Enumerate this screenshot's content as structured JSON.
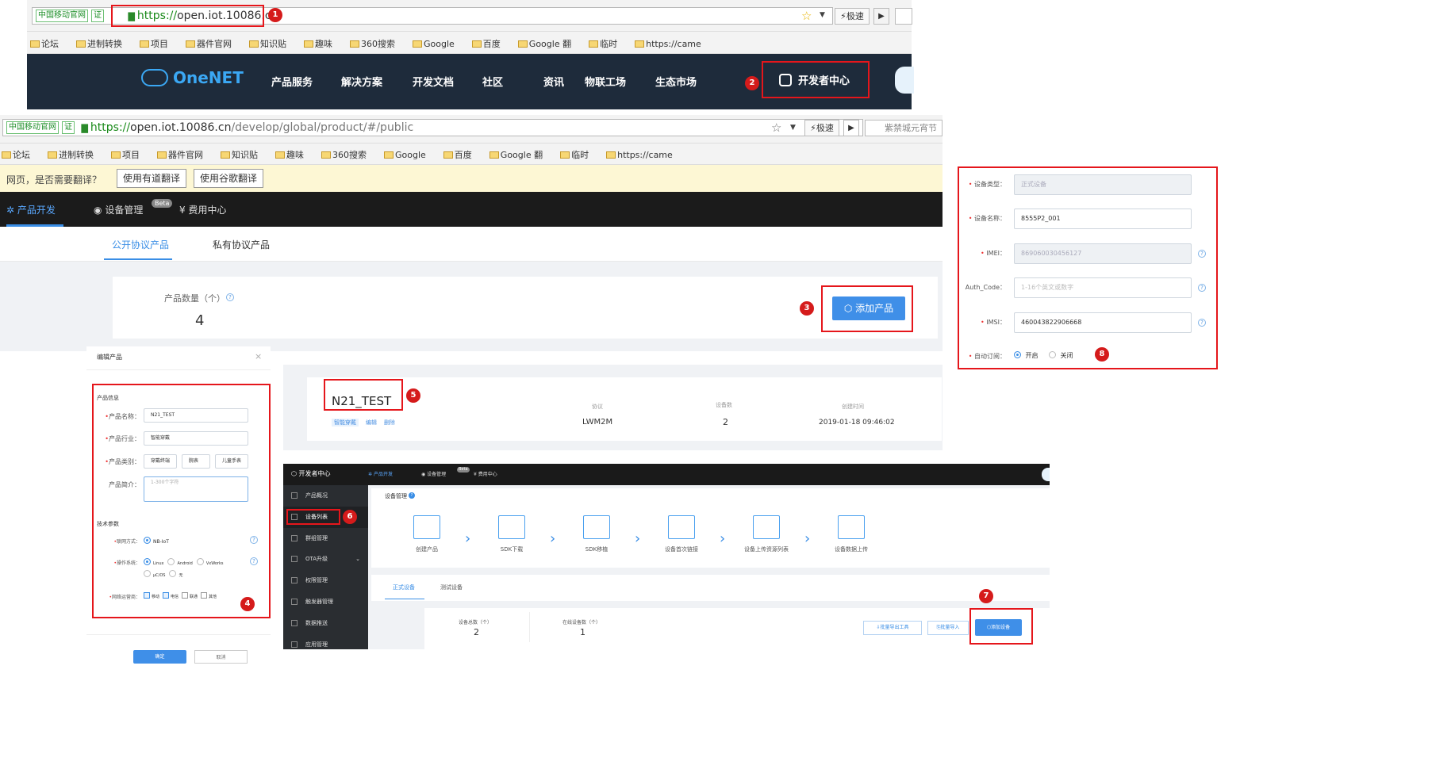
{
  "browser1": {
    "gov_badge": "中国移动官网",
    "url_scheme": "https://",
    "url_host": "open.iot.10086.cn",
    "speed_label": "极速"
  },
  "bookmarks1": [
    "论坛",
    "进制转换",
    "项目",
    "器件官网",
    "知识贴",
    "趣味",
    "360搜索",
    "Google",
    "百度",
    "Google 翻",
    "临时",
    "https://came"
  ],
  "onenet_nav": {
    "logo": "OneNET",
    "items": [
      "产品服务",
      "解决方案",
      "开发文档",
      "社区",
      "资讯",
      "物联工场",
      "生态市场"
    ],
    "dev_center": "开发者中心"
  },
  "browser2": {
    "gov_badge": "中国移动官网",
    "url_scheme": "https://",
    "url_host": "open.iot.10086.cn",
    "url_path": "/develop/global/product/#/public",
    "speed_label": "极速",
    "next_tab": "紫禁城元宵节"
  },
  "bookmarks2": [
    "论坛",
    "进制转换",
    "项目",
    "器件官网",
    "知识贴",
    "趣味",
    "360搜索",
    "Google",
    "百度",
    "Google 翻",
    "临时",
    "https://came"
  ],
  "translate_bar": {
    "prompt": "网页，是否需要翻译？",
    "youdao": "使用有道翻译",
    "google": "使用谷歌翻译"
  },
  "dev_nav": {
    "product_dev": "产品开发",
    "device_mgmt": "设备管理",
    "beta": "Beta",
    "fee_center": "费用中心"
  },
  "protocol_tabs": {
    "public": "公开协议产品",
    "private": "私有协议产品"
  },
  "product_summary": {
    "count_label": "产品数量（个）",
    "count_value": "4",
    "add_button": "添加产品"
  },
  "edit_panel": {
    "title": "编辑产品",
    "close": "×",
    "section_info": "产品信息",
    "name_label": "产品名称：",
    "name_value": "N21_TEST",
    "industry_label": "产品行业：",
    "industry_value": "智能穿戴",
    "category_label": "产品类别：",
    "category_values": [
      "穿戴终端",
      "腕表",
      "儿童手表"
    ],
    "intro_label": "产品简介：",
    "intro_placeholder": "1-300个字符",
    "section_tech": "技术参数",
    "network_label": "联网方式：",
    "network_value": "NB-IoT",
    "os_label": "操作系统：",
    "os_options": [
      "Linux",
      "Android",
      "VxWorks",
      "μC/OS",
      "无"
    ],
    "carrier_label": "网络运营商：",
    "carrier_options": [
      "移动",
      "电信",
      "联通",
      "其他"
    ],
    "confirm": "确定",
    "cancel": "取消"
  },
  "product_card": {
    "name": "N21_TEST",
    "tags": [
      "智能穿戴",
      "编辑",
      "删除"
    ],
    "protocol_label": "协议",
    "protocol_value": "LWM2M",
    "device_count_label": "设备数",
    "device_count_value": "2",
    "created_label": "创建时间",
    "created_value": "2019-01-18 09:46:02"
  },
  "console": {
    "dev_center": "开发者中心",
    "product_dev": "产品开发",
    "device_mgmt": "设备管理",
    "beta": "Beta",
    "fee_center": "费用中心",
    "sidebar": [
      "产品概况",
      "设备列表",
      "群组管理",
      "OTA升级",
      "权限管理",
      "触发器管理",
      "数据推送",
      "应用管理"
    ],
    "section_title": "设备管理",
    "steps": [
      "创建产品",
      "SDK下载",
      "SDK移植",
      "设备首次链接",
      "设备上传资源列表",
      "设备数据上传"
    ],
    "tabs": [
      "正式设备",
      "测试设备"
    ],
    "total_label": "设备总数（个）",
    "total_value": "2",
    "online_label": "在线设备数（个）",
    "online_value": "1",
    "export_btn": "批量导出工具",
    "import_btn": "批量导入",
    "add_device": "添加设备"
  },
  "device_form": {
    "type_label": "设备类型：",
    "type_value": "正式设备",
    "name_label": "设备名称：",
    "name_value": "8555P2_001",
    "imei_label": "IMEI：",
    "imei_value": "869060030456127",
    "auth_label": "Auth_Code：",
    "auth_placeholder": "1-16个英文或数字",
    "imsi_label": "IMSI：",
    "imsi_value": "460043822906668",
    "sub_label": "自动订阅：",
    "sub_on": "开启",
    "sub_off": "关闭"
  },
  "markers": [
    "1",
    "2",
    "3",
    "4",
    "5",
    "6",
    "7",
    "8"
  ],
  "colors": {
    "highlight": "#e5161b",
    "marker": "#d51b1b",
    "accent": "#3a8ee6",
    "nav_dark": "#1e2b3b"
  }
}
